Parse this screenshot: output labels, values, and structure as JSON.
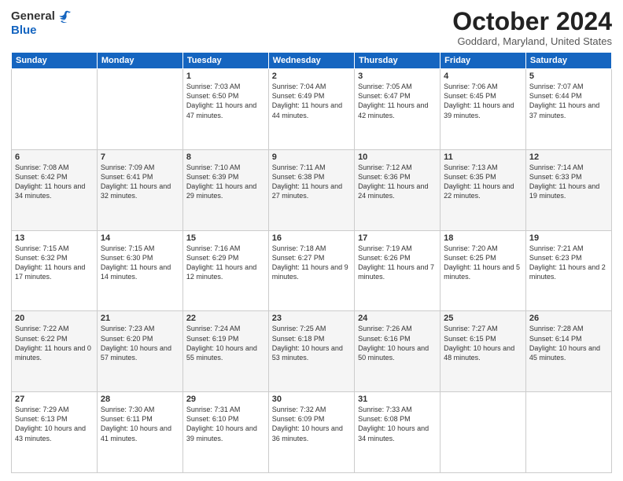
{
  "header": {
    "logo_general": "General",
    "logo_blue": "Blue",
    "title": "October 2024",
    "location": "Goddard, Maryland, United States"
  },
  "days_of_week": [
    "Sunday",
    "Monday",
    "Tuesday",
    "Wednesday",
    "Thursday",
    "Friday",
    "Saturday"
  ],
  "weeks": [
    [
      {
        "day": "",
        "sunrise": "",
        "sunset": "",
        "daylight": ""
      },
      {
        "day": "",
        "sunrise": "",
        "sunset": "",
        "daylight": ""
      },
      {
        "day": "1",
        "sunrise": "Sunrise: 7:03 AM",
        "sunset": "Sunset: 6:50 PM",
        "daylight": "Daylight: 11 hours and 47 minutes."
      },
      {
        "day": "2",
        "sunrise": "Sunrise: 7:04 AM",
        "sunset": "Sunset: 6:49 PM",
        "daylight": "Daylight: 11 hours and 44 minutes."
      },
      {
        "day": "3",
        "sunrise": "Sunrise: 7:05 AM",
        "sunset": "Sunset: 6:47 PM",
        "daylight": "Daylight: 11 hours and 42 minutes."
      },
      {
        "day": "4",
        "sunrise": "Sunrise: 7:06 AM",
        "sunset": "Sunset: 6:45 PM",
        "daylight": "Daylight: 11 hours and 39 minutes."
      },
      {
        "day": "5",
        "sunrise": "Sunrise: 7:07 AM",
        "sunset": "Sunset: 6:44 PM",
        "daylight": "Daylight: 11 hours and 37 minutes."
      }
    ],
    [
      {
        "day": "6",
        "sunrise": "Sunrise: 7:08 AM",
        "sunset": "Sunset: 6:42 PM",
        "daylight": "Daylight: 11 hours and 34 minutes."
      },
      {
        "day": "7",
        "sunrise": "Sunrise: 7:09 AM",
        "sunset": "Sunset: 6:41 PM",
        "daylight": "Daylight: 11 hours and 32 minutes."
      },
      {
        "day": "8",
        "sunrise": "Sunrise: 7:10 AM",
        "sunset": "Sunset: 6:39 PM",
        "daylight": "Daylight: 11 hours and 29 minutes."
      },
      {
        "day": "9",
        "sunrise": "Sunrise: 7:11 AM",
        "sunset": "Sunset: 6:38 PM",
        "daylight": "Daylight: 11 hours and 27 minutes."
      },
      {
        "day": "10",
        "sunrise": "Sunrise: 7:12 AM",
        "sunset": "Sunset: 6:36 PM",
        "daylight": "Daylight: 11 hours and 24 minutes."
      },
      {
        "day": "11",
        "sunrise": "Sunrise: 7:13 AM",
        "sunset": "Sunset: 6:35 PM",
        "daylight": "Daylight: 11 hours and 22 minutes."
      },
      {
        "day": "12",
        "sunrise": "Sunrise: 7:14 AM",
        "sunset": "Sunset: 6:33 PM",
        "daylight": "Daylight: 11 hours and 19 minutes."
      }
    ],
    [
      {
        "day": "13",
        "sunrise": "Sunrise: 7:15 AM",
        "sunset": "Sunset: 6:32 PM",
        "daylight": "Daylight: 11 hours and 17 minutes."
      },
      {
        "day": "14",
        "sunrise": "Sunrise: 7:15 AM",
        "sunset": "Sunset: 6:30 PM",
        "daylight": "Daylight: 11 hours and 14 minutes."
      },
      {
        "day": "15",
        "sunrise": "Sunrise: 7:16 AM",
        "sunset": "Sunset: 6:29 PM",
        "daylight": "Daylight: 11 hours and 12 minutes."
      },
      {
        "day": "16",
        "sunrise": "Sunrise: 7:18 AM",
        "sunset": "Sunset: 6:27 PM",
        "daylight": "Daylight: 11 hours and 9 minutes."
      },
      {
        "day": "17",
        "sunrise": "Sunrise: 7:19 AM",
        "sunset": "Sunset: 6:26 PM",
        "daylight": "Daylight: 11 hours and 7 minutes."
      },
      {
        "day": "18",
        "sunrise": "Sunrise: 7:20 AM",
        "sunset": "Sunset: 6:25 PM",
        "daylight": "Daylight: 11 hours and 5 minutes."
      },
      {
        "day": "19",
        "sunrise": "Sunrise: 7:21 AM",
        "sunset": "Sunset: 6:23 PM",
        "daylight": "Daylight: 11 hours and 2 minutes."
      }
    ],
    [
      {
        "day": "20",
        "sunrise": "Sunrise: 7:22 AM",
        "sunset": "Sunset: 6:22 PM",
        "daylight": "Daylight: 11 hours and 0 minutes."
      },
      {
        "day": "21",
        "sunrise": "Sunrise: 7:23 AM",
        "sunset": "Sunset: 6:20 PM",
        "daylight": "Daylight: 10 hours and 57 minutes."
      },
      {
        "day": "22",
        "sunrise": "Sunrise: 7:24 AM",
        "sunset": "Sunset: 6:19 PM",
        "daylight": "Daylight: 10 hours and 55 minutes."
      },
      {
        "day": "23",
        "sunrise": "Sunrise: 7:25 AM",
        "sunset": "Sunset: 6:18 PM",
        "daylight": "Daylight: 10 hours and 53 minutes."
      },
      {
        "day": "24",
        "sunrise": "Sunrise: 7:26 AM",
        "sunset": "Sunset: 6:16 PM",
        "daylight": "Daylight: 10 hours and 50 minutes."
      },
      {
        "day": "25",
        "sunrise": "Sunrise: 7:27 AM",
        "sunset": "Sunset: 6:15 PM",
        "daylight": "Daylight: 10 hours and 48 minutes."
      },
      {
        "day": "26",
        "sunrise": "Sunrise: 7:28 AM",
        "sunset": "Sunset: 6:14 PM",
        "daylight": "Daylight: 10 hours and 45 minutes."
      }
    ],
    [
      {
        "day": "27",
        "sunrise": "Sunrise: 7:29 AM",
        "sunset": "Sunset: 6:13 PM",
        "daylight": "Daylight: 10 hours and 43 minutes."
      },
      {
        "day": "28",
        "sunrise": "Sunrise: 7:30 AM",
        "sunset": "Sunset: 6:11 PM",
        "daylight": "Daylight: 10 hours and 41 minutes."
      },
      {
        "day": "29",
        "sunrise": "Sunrise: 7:31 AM",
        "sunset": "Sunset: 6:10 PM",
        "daylight": "Daylight: 10 hours and 39 minutes."
      },
      {
        "day": "30",
        "sunrise": "Sunrise: 7:32 AM",
        "sunset": "Sunset: 6:09 PM",
        "daylight": "Daylight: 10 hours and 36 minutes."
      },
      {
        "day": "31",
        "sunrise": "Sunrise: 7:33 AM",
        "sunset": "Sunset: 6:08 PM",
        "daylight": "Daylight: 10 hours and 34 minutes."
      },
      {
        "day": "",
        "sunrise": "",
        "sunset": "",
        "daylight": ""
      },
      {
        "day": "",
        "sunrise": "",
        "sunset": "",
        "daylight": ""
      }
    ]
  ]
}
